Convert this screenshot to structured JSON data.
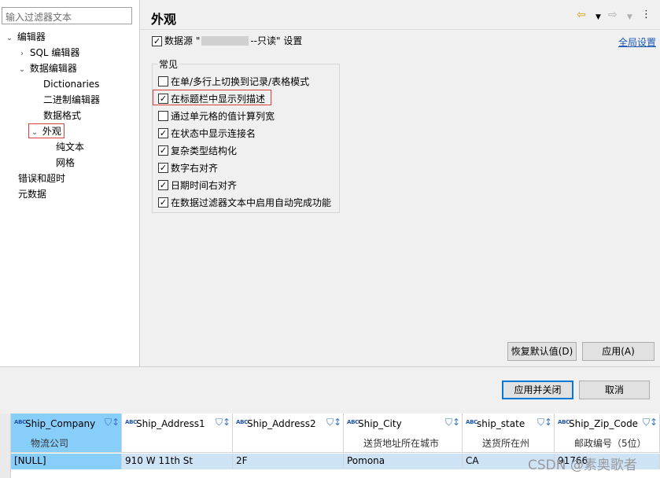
{
  "filter": {
    "placeholder": "输入过滤器文本"
  },
  "tree": {
    "editor": "编辑器",
    "sql_editor": "SQL 编辑器",
    "data_editor": "数据编辑器",
    "dictionaries": "Dictionaries",
    "binary_editor": "二进制编辑器",
    "data_format": "数据格式",
    "appearance": "外观",
    "plain_text": "纯文本",
    "grid": "网格",
    "errors_timeouts": "错误和超时",
    "metadata": "元数据"
  },
  "page": {
    "title": "外观",
    "datasource_label_prefix": "数据源 \"",
    "datasource_label_suffix": "--只读\" 设置",
    "global_settings_link": "全局设置",
    "group_title": "常见",
    "options": [
      {
        "label": "在单/多行上切换到记录/表格模式",
        "checked": false
      },
      {
        "label": "在标题栏中显示列描述",
        "checked": true
      },
      {
        "label": "通过单元格的值计算列宽",
        "checked": false
      },
      {
        "label": "在状态中显示连接名",
        "checked": true
      },
      {
        "label": "复杂类型结构化",
        "checked": true
      },
      {
        "label": "数字右对齐",
        "checked": true
      },
      {
        "label": "日期时间右对齐",
        "checked": true
      },
      {
        "label": "在数据过滤器文本中启用自动完成功能",
        "checked": true
      }
    ],
    "restore_defaults": "恢复默认值(D)",
    "apply": "应用(A)"
  },
  "dialog": {
    "apply_close": "应用并关闭",
    "cancel": "取消"
  },
  "grid": {
    "columns": [
      {
        "name": "Ship_Company",
        "desc": "物流公司"
      },
      {
        "name": "Ship_Address1",
        "desc": ""
      },
      {
        "name": "Ship_Address2",
        "desc": ""
      },
      {
        "name": "Ship_City",
        "desc": "送货地址所在城市"
      },
      {
        "name": "ship_state",
        "desc": "送货所在州"
      },
      {
        "name": "Ship_Zip_Code",
        "desc": "邮政编号（5位）"
      }
    ],
    "row": [
      "[NULL]",
      "910 W 11th St",
      "2F",
      "Pomona",
      "CA",
      "91766"
    ],
    "type_badge": "ABC"
  },
  "watermark": "CSDN @素奥歌者",
  "icons": {
    "back": "arrow-left-icon",
    "forward": "arrow-right-icon",
    "menu": "more-vertical-icon",
    "filter": "filter-icon"
  },
  "colors": {
    "accent": "#0078d7",
    "selected_header": "#87cefa",
    "highlight_box": "#d94040",
    "link": "#1a57b0"
  }
}
